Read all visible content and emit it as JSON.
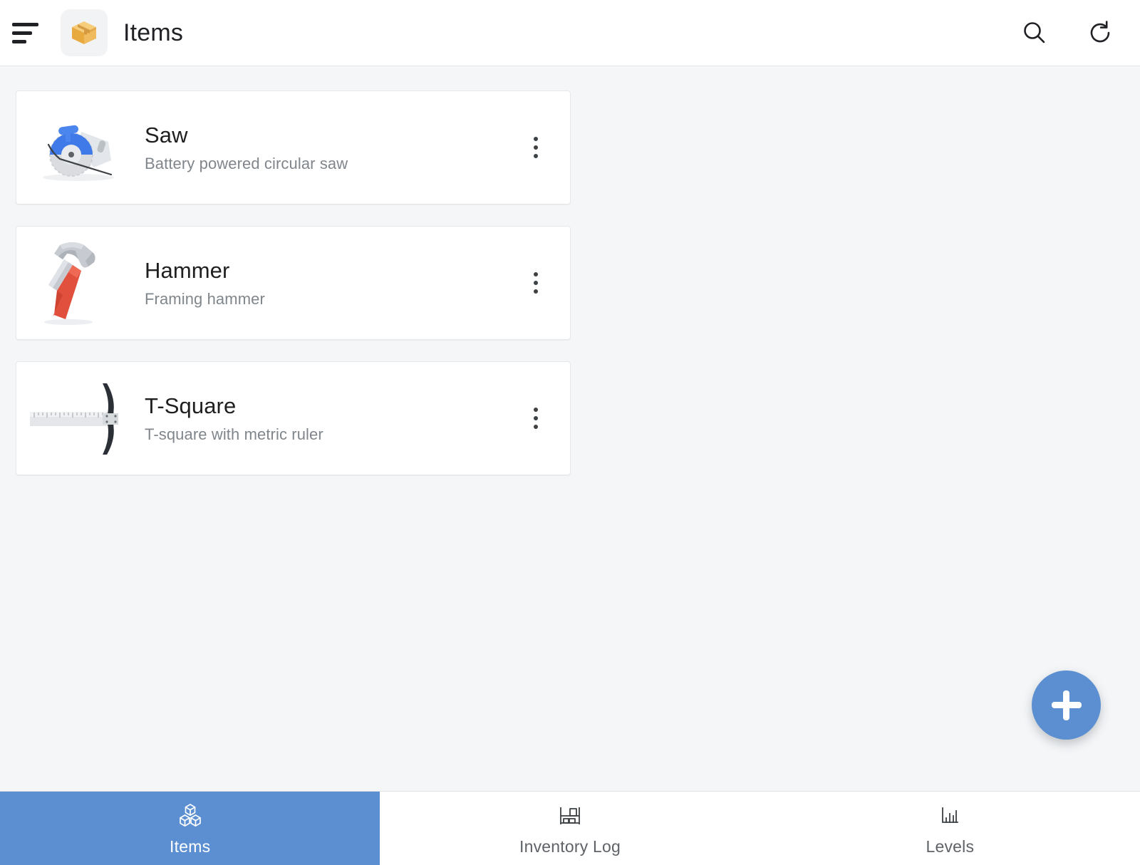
{
  "app": {
    "title": "Items",
    "menu_icon": "hamburger-menu-icon",
    "app_logo_icon": "package-box-icon",
    "actions": [
      {
        "name": "search",
        "icon": "search-icon",
        "label": "Search"
      },
      {
        "name": "refresh",
        "icon": "refresh-icon",
        "label": "Refresh"
      }
    ]
  },
  "colors": {
    "accent": "#5b8fd1",
    "page_background": "#f4f6f8",
    "card_background": "#ffffff",
    "title_text": "#1f1f1f",
    "subtitle_text": "#80868b",
    "hammer_handle": "#e0503c",
    "saw_blade": "#4285f4"
  },
  "items": [
    {
      "title": "Saw",
      "subtitle": "Battery powered circular saw",
      "icon": "circular-saw-icon",
      "menu_icon": "more-vertical-icon"
    },
    {
      "title": "Hammer",
      "subtitle": "Framing hammer",
      "icon": "hammer-icon",
      "menu_icon": "more-vertical-icon"
    },
    {
      "title": "T-Square",
      "subtitle": "T-square with metric ruler",
      "icon": "t-square-icon",
      "menu_icon": "more-vertical-icon"
    }
  ],
  "fab": {
    "label": "Add item",
    "icon": "plus-icon"
  },
  "bottom_nav": {
    "active_index": 0,
    "items": [
      {
        "label": "Items",
        "icon": "boxes-icon"
      },
      {
        "label": "Inventory Log",
        "icon": "shelf-icon"
      },
      {
        "label": "Levels",
        "icon": "bar-chart-icon"
      }
    ]
  }
}
